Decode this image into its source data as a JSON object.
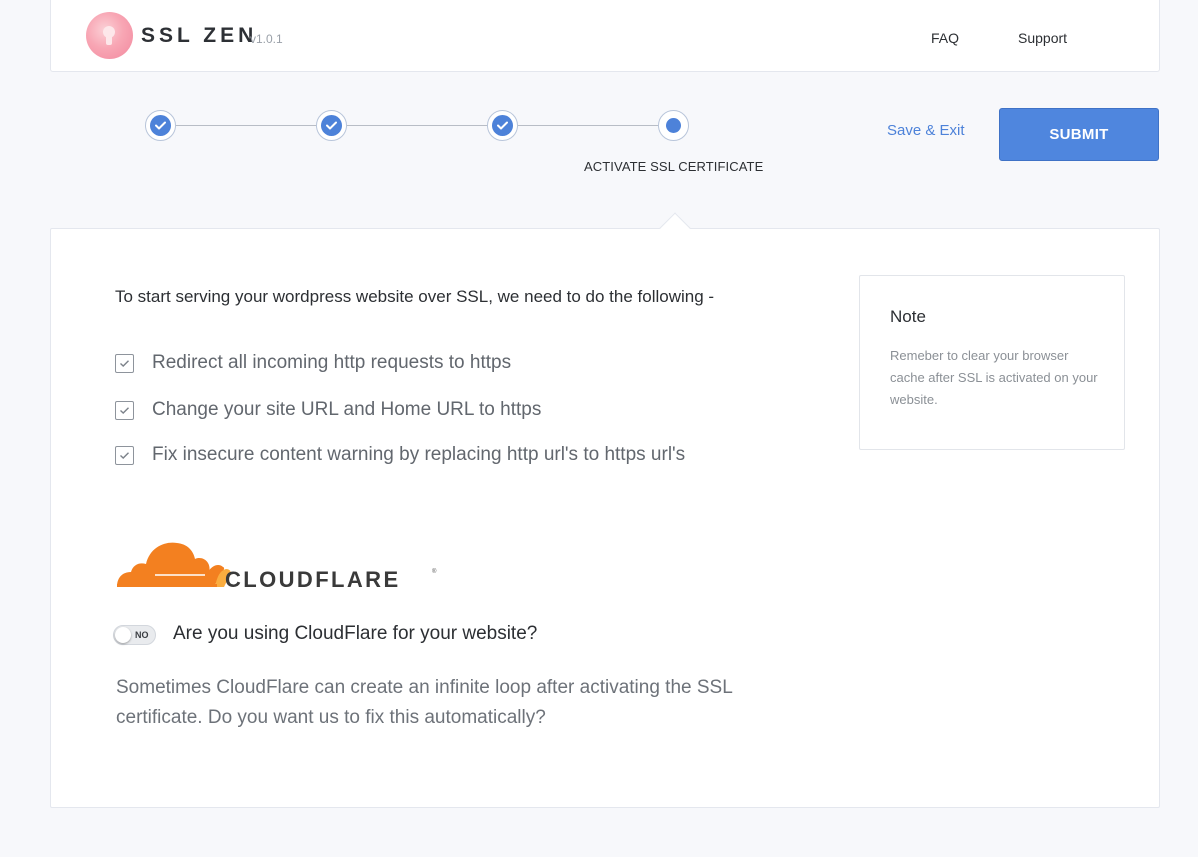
{
  "header": {
    "brand": "SSL ZEN",
    "version": "v1.0.1",
    "nav": [
      {
        "label": "FAQ"
      },
      {
        "label": "Support"
      }
    ]
  },
  "stepper": {
    "steps": [
      {
        "status": "complete"
      },
      {
        "status": "complete"
      },
      {
        "status": "complete"
      },
      {
        "status": "active",
        "label": "ACTIVATE SSL CERTIFICATE"
      }
    ],
    "save_exit_label": "Save & Exit",
    "submit_label": "SUBMIT"
  },
  "main": {
    "intro": "To start serving your wordpress website over SSL, we need to do the following -",
    "tasks": [
      {
        "label": "Redirect all incoming http requests to https",
        "checked": true
      },
      {
        "label": "Change your site URL and Home URL to https",
        "checked": true
      },
      {
        "label": "Fix insecure content warning by replacing http url's to https url's",
        "checked": true
      }
    ],
    "cloudflare": {
      "logo_text": "CLOUDFLARE",
      "logo_reg": "®",
      "toggle_state": "NO",
      "question": "Are you using CloudFlare for your website?",
      "description": "Sometimes CloudFlare can create an infinite loop after activating the SSL certificate. Do you want us to fix this automatically?"
    }
  },
  "note": {
    "title": "Note",
    "body": "Remeber to clear your browser cache after SSL is activated on your website."
  },
  "colors": {
    "accent": "#4d82d9",
    "cloudflare_orange": "#f38020",
    "cloudflare_light": "#faad3f"
  }
}
